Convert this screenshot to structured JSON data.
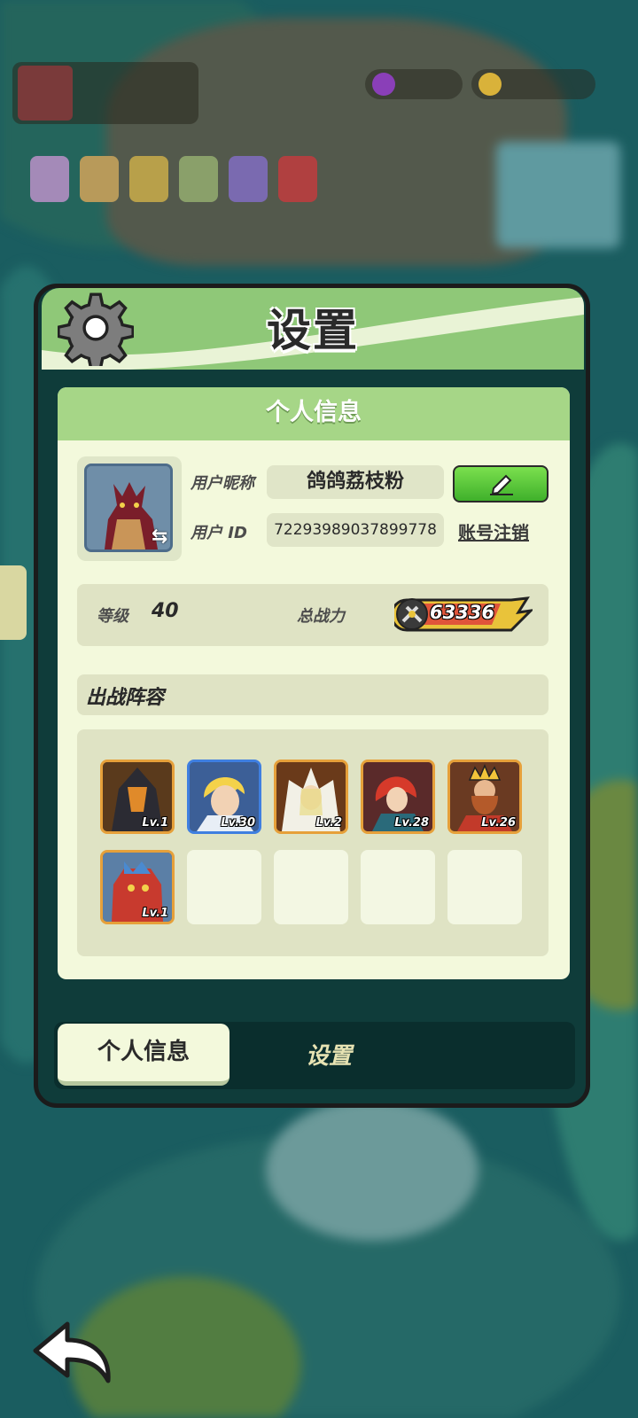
{
  "dialog": {
    "title": "设置"
  },
  "panel": {
    "header": "个人信息"
  },
  "profile": {
    "nickname_label": "用户昵称",
    "nickname": "鸽鸽荔枝粉",
    "id_label": "用户  ID",
    "user_id": "7229398903789977​8",
    "deactivate_label": "账号注销"
  },
  "stats": {
    "level_label": "等级",
    "level": "40",
    "power_label": "总战力",
    "power": "63336"
  },
  "lineup": {
    "title": "出战阵容",
    "heroes": [
      {
        "level": "Lv.1"
      },
      {
        "level": "Lv.30"
      },
      {
        "level": "Lv.2"
      },
      {
        "level": "Lv.28"
      },
      {
        "level": "Lv.26"
      },
      {
        "level": "Lv.1"
      }
    ],
    "empty_slots": 4
  },
  "tabs": [
    {
      "label": "个人信息",
      "active": true
    },
    {
      "label": "设置",
      "active": false
    }
  ],
  "icons": [
    "gear-icon",
    "swap-icon",
    "edit-icon",
    "sword-power-icon",
    "back-arrow-icon"
  ]
}
